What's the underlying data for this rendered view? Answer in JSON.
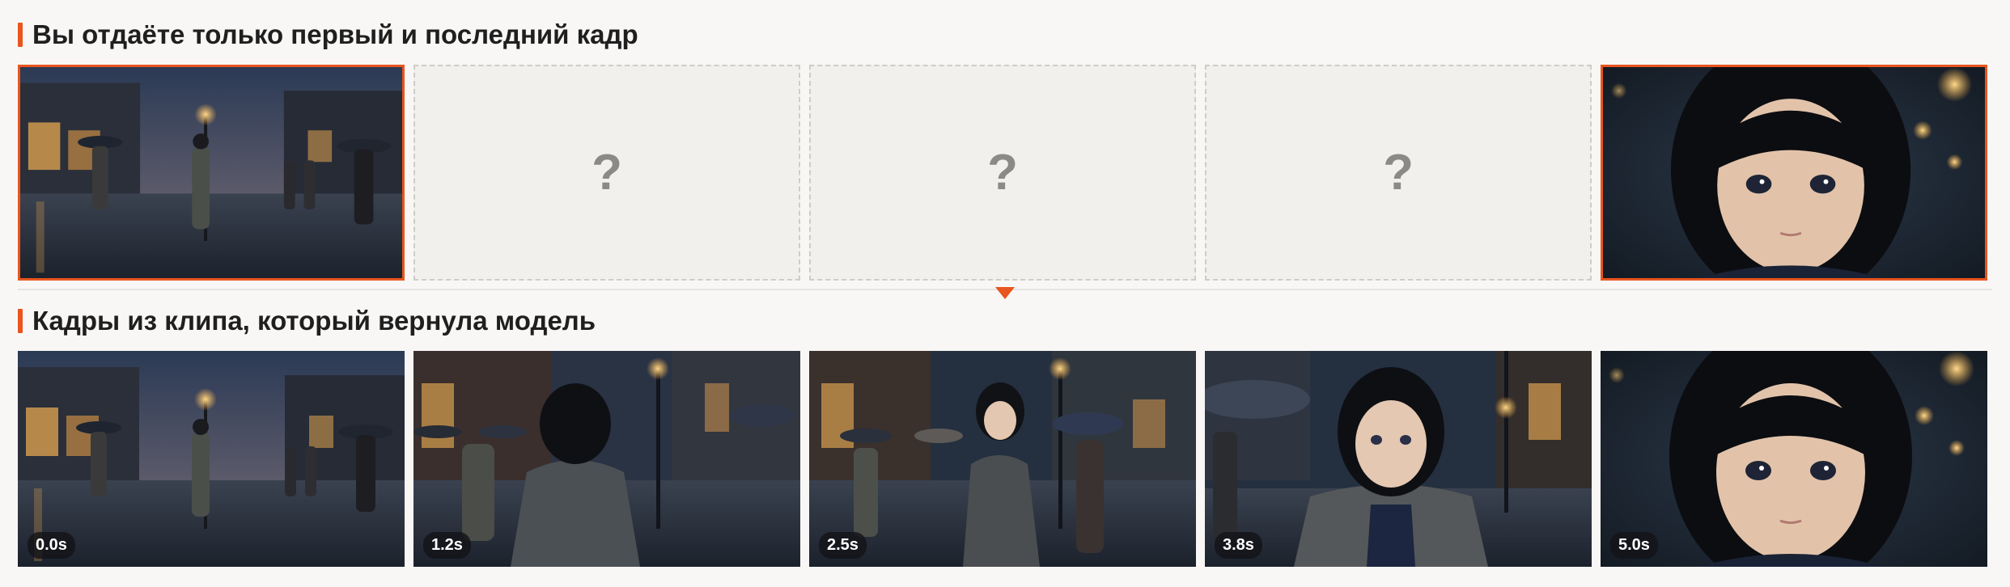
{
  "input_section": {
    "title": "Вы отдаёте только первый и последний кадр",
    "frames": [
      {
        "kind": "street"
      },
      {
        "kind": "unknown",
        "mark": "?"
      },
      {
        "kind": "unknown",
        "mark": "?"
      },
      {
        "kind": "unknown",
        "mark": "?"
      },
      {
        "kind": "closeup"
      }
    ]
  },
  "output_section": {
    "title": "Кадры из клипа, который вернула модель",
    "frames": [
      {
        "kind": "street",
        "time": "0.0s"
      },
      {
        "kind": "back",
        "time": "1.2s"
      },
      {
        "kind": "turn",
        "time": "2.5s"
      },
      {
        "kind": "near",
        "time": "3.8s"
      },
      {
        "kind": "closeup",
        "time": "5.0s"
      }
    ]
  },
  "colors": {
    "accent": "#e8551f",
    "placeholder_bg": "#f1f0ed",
    "page_bg": "#f8f7f5"
  }
}
